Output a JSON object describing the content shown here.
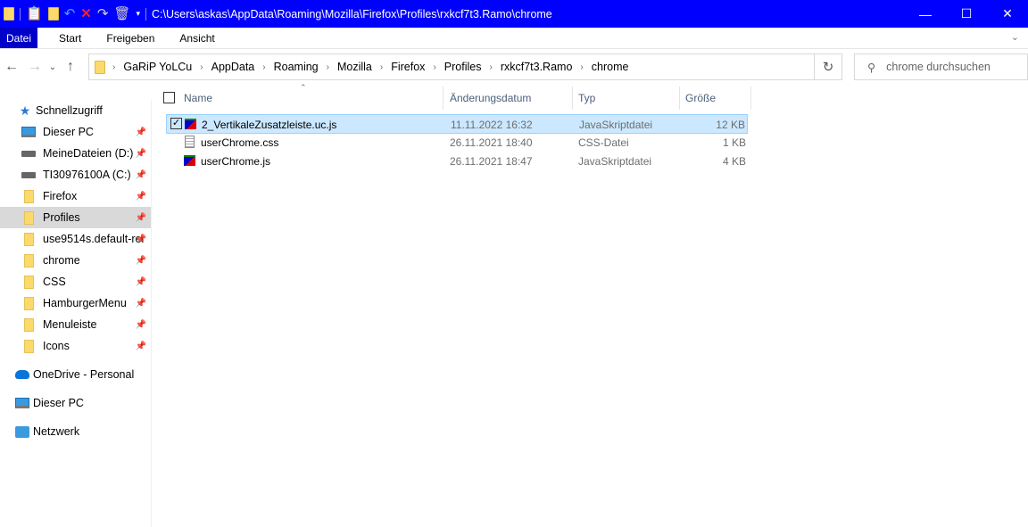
{
  "titlebar": {
    "path": "C:\\Users\\askas\\AppData\\Roaming\\Mozilla\\Firefox\\Profiles\\rxkcf7t3.Ramo\\chrome",
    "minimize": "—",
    "maximize": "☐",
    "close": "✕"
  },
  "ribbon": {
    "tabs": [
      {
        "label": "Datei"
      },
      {
        "label": "Start"
      },
      {
        "label": "Freigeben"
      },
      {
        "label": "Ansicht"
      }
    ]
  },
  "address": {
    "crumbs": [
      "GaRiP YoLCu",
      "AppData",
      "Roaming",
      "Mozilla",
      "Firefox",
      "Profiles",
      "rxkcf7t3.Ramo",
      "chrome"
    ]
  },
  "search": {
    "placeholder": "chrome durchsuchen"
  },
  "sidebar": {
    "quick_access": "Schnellzugriff",
    "pinned": [
      {
        "label": "Dieser PC",
        "icon": "pc"
      },
      {
        "label": "MeineDateien (D:)",
        "icon": "drive"
      },
      {
        "label": "TI30976100A (C:)",
        "icon": "drive"
      },
      {
        "label": "Firefox",
        "icon": "folder"
      },
      {
        "label": "Profiles",
        "icon": "folder",
        "selected": true
      },
      {
        "label": "use9514s.default-rel",
        "icon": "folder"
      },
      {
        "label": "chrome",
        "icon": "folder"
      },
      {
        "label": "CSS",
        "icon": "folder"
      },
      {
        "label": "HamburgerMenu",
        "icon": "folder"
      },
      {
        "label": "Menuleiste",
        "icon": "folder"
      },
      {
        "label": "Icons",
        "icon": "folder"
      }
    ],
    "onedrive": "OneDrive - Personal",
    "thispc": "Dieser PC",
    "network": "Netzwerk"
  },
  "columns": {
    "name": "Name",
    "date": "Änderungsdatum",
    "type": "Typ",
    "size": "Größe"
  },
  "files": [
    {
      "name": "2_VertikaleZusatzleiste.uc.js",
      "date": "11.11.2022 16:32",
      "type": "JavaSkriptdatei",
      "size": "12 KB",
      "icon": "js",
      "selected": true
    },
    {
      "name": "userChrome.css",
      "date": "26.11.2021 18:40",
      "type": "CSS-Datei",
      "size": "1 KB",
      "icon": "text"
    },
    {
      "name": "userChrome.js",
      "date": "26.11.2021 18:47",
      "type": "JavaSkriptdatei",
      "size": "4 KB",
      "icon": "js"
    }
  ],
  "colors": {
    "titlebar": "#0000ff",
    "selection": "#cce8ff"
  }
}
